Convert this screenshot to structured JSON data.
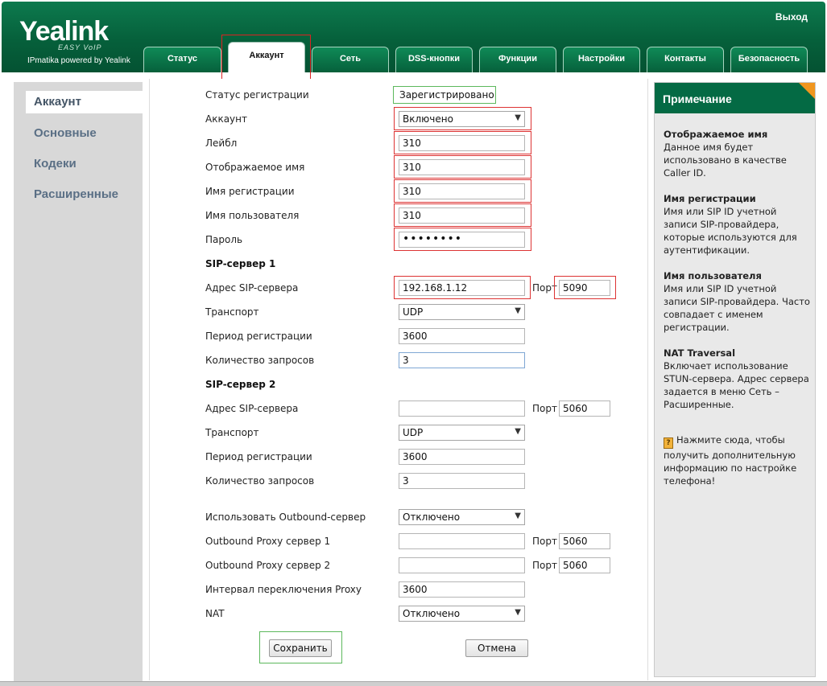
{
  "header": {
    "logo": "Yealink",
    "logo_sub": "EASY VoIP",
    "powered_by": "IPmatika powered by Yealink",
    "logout": "Выход"
  },
  "tabs": [
    {
      "label": "Статус"
    },
    {
      "label": "Аккаунт"
    },
    {
      "label": "Сеть"
    },
    {
      "label": "DSS-кнопки"
    },
    {
      "label": "Функции"
    },
    {
      "label": "Настройки"
    },
    {
      "label": "Контакты"
    },
    {
      "label": "Безопасность"
    }
  ],
  "sidebar": {
    "items": [
      {
        "label": "Аккаунт"
      },
      {
        "label": "Основные"
      },
      {
        "label": "Кодеки"
      },
      {
        "label": "Расширенные"
      }
    ]
  },
  "form": {
    "reg_status_label": "Статус регистрации",
    "reg_status_value": "Зарегистрировано",
    "account_label": "Аккаунт",
    "account_value": "Включено",
    "label_label": "Лейбл",
    "label_value": "310",
    "display_name_label": "Отображаемое имя",
    "display_name_value": "310",
    "reg_name_label": "Имя регистрации",
    "reg_name_value": "310",
    "username_label": "Имя пользователя",
    "username_value": "310",
    "password_label": "Пароль",
    "password_value": "••••••••",
    "port_label": "Порт",
    "sip1": {
      "title": "SIP-сервер 1",
      "server_label": "Адрес SIP-сервера",
      "server_value": "192.168.1.12",
      "port_value": "5090",
      "transport_label": "Транспорт",
      "transport_value": "UDP",
      "period_label": "Период регистрации",
      "period_value": "3600",
      "retries_label": "Количество запросов",
      "retries_value": "3"
    },
    "sip2": {
      "title": "SIP-сервер 2",
      "server_label": "Адрес SIP-сервера",
      "server_value": "",
      "port_value": "5060",
      "transport_label": "Транспорт",
      "transport_value": "UDP",
      "period_label": "Период регистрации",
      "period_value": "3600",
      "retries_label": "Количество запросов",
      "retries_value": "3"
    },
    "outbound_label": "Использовать Outbound-сервер",
    "outbound_value": "Отключено",
    "proxy1_label": "Outbound Proxy сервер 1",
    "proxy1_value": "",
    "proxy1_port": "5060",
    "proxy2_label": "Outbound Proxy сервер 2",
    "proxy2_value": "",
    "proxy2_port": "5060",
    "proxy_interval_label": "Интервал переключения Proxy",
    "proxy_interval_value": "3600",
    "nat_label": "NAT",
    "nat_value": "Отключено",
    "save_label": "Сохранить",
    "cancel_label": "Отмена"
  },
  "note": {
    "title": "Примечание",
    "blocks": [
      {
        "title": "Отображаемое имя",
        "text": "Данное имя будет использовано в качестве Caller ID."
      },
      {
        "title": "Имя регистрации",
        "text": "Имя или SIP ID учетной записи SIP-провайдера, которые используются для аутентификации."
      },
      {
        "title": "Имя пользователя",
        "text": "Имя или SIP ID учетной записи SIP-провайдера. Часто совпадает с именем регистрации."
      },
      {
        "title": "NAT Traversal",
        "text": "Включает использование STUN-сервера. Адрес сервера задается в меню Сеть – Расширенные."
      }
    ],
    "help_text": "Нажмите сюда, чтобы получить дополнительную информацию по настройке телефона!"
  }
}
